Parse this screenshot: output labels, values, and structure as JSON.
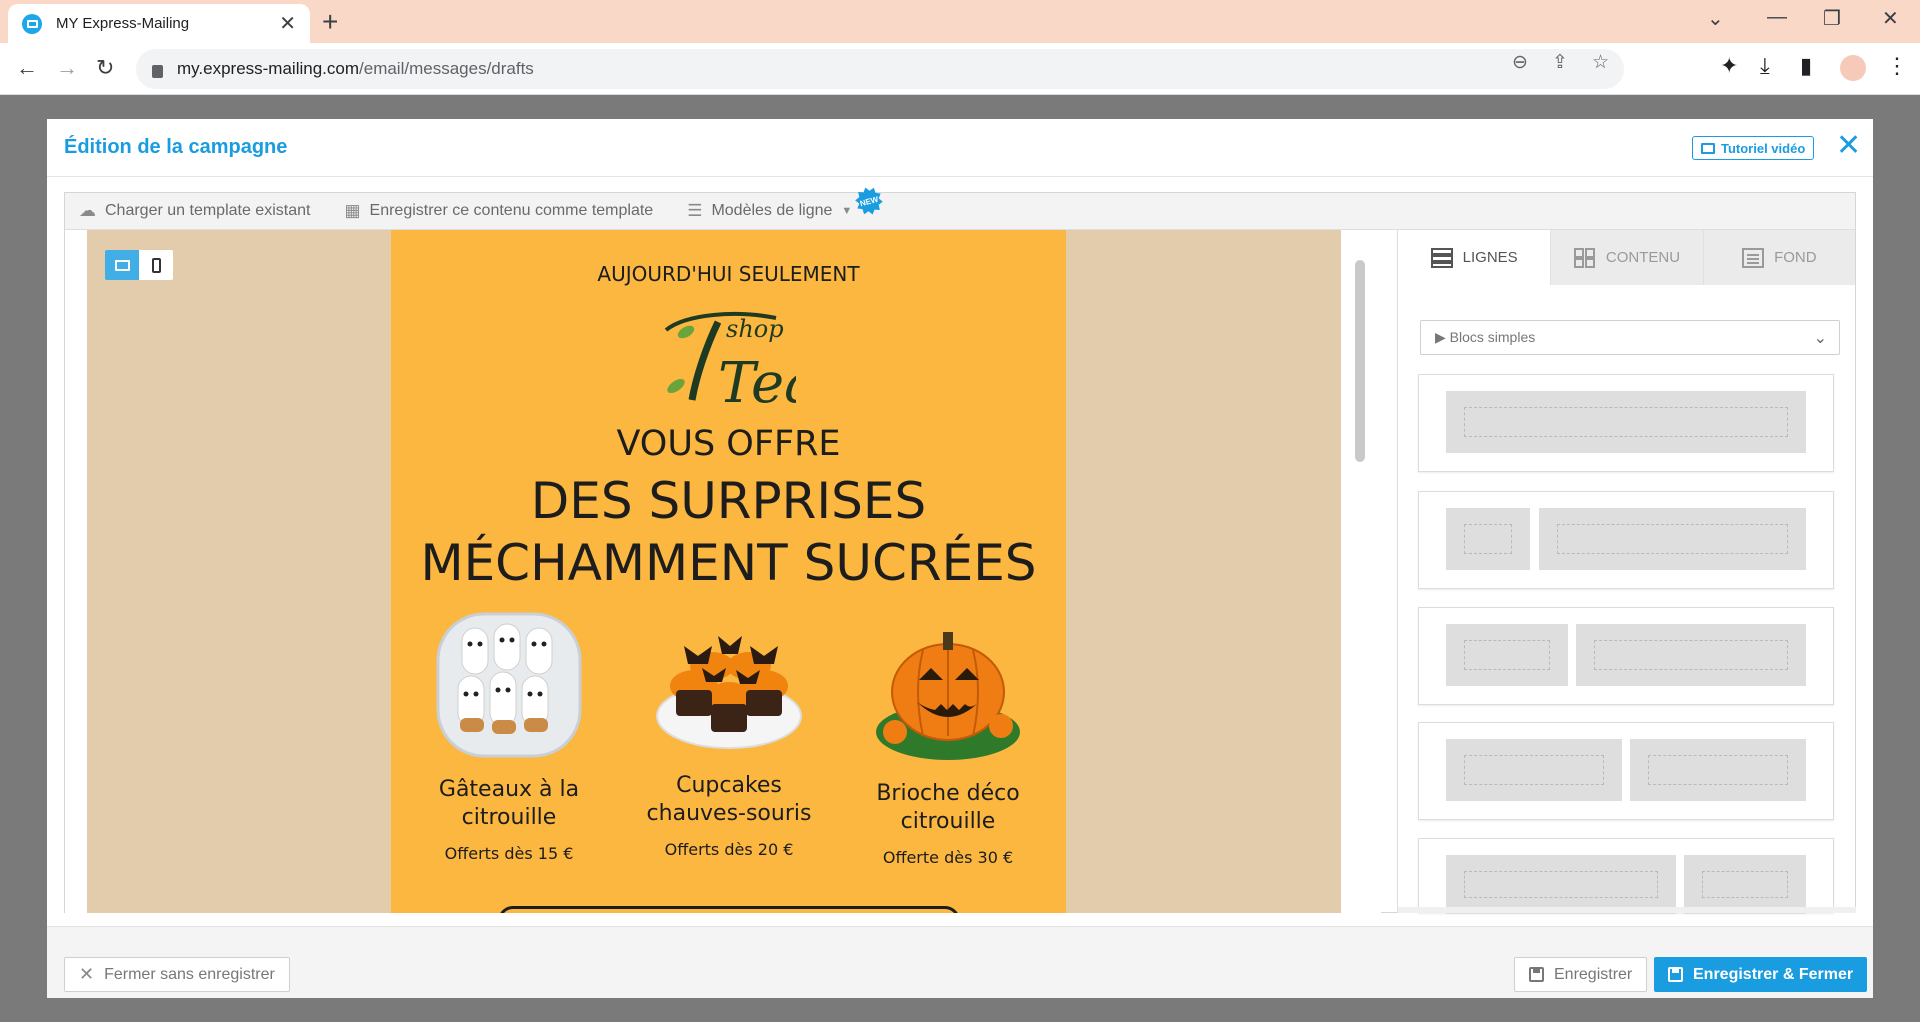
{
  "browser": {
    "tab_title": "MY Express-Mailing",
    "url_host": "my.express-mailing.com",
    "url_path": "/email/messages/drafts"
  },
  "modal": {
    "title": "Édition de la campagne",
    "tutorial_label": "Tutoriel vidéo"
  },
  "toolbar": {
    "load_template": "Charger un template existant",
    "save_as_template": "Enregistrer ce contenu comme template",
    "row_models": "Modèles de ligne",
    "new_badge": "NEW"
  },
  "email": {
    "kicker": "AUJOURD'HUI SEULEMENT",
    "logo_text_small": "shop",
    "logo_text_big": "Tea",
    "line1": "VOUS OFFRE",
    "line2": "DES SURPRISES",
    "line3": "MÉCHAMMENT SUCRÉES",
    "products": [
      {
        "name": "Gâteaux à la citrouille",
        "price": "Offerts dès 15 €"
      },
      {
        "name": "Cupcakes chauves-souris",
        "price": "Offerts dès 20 €"
      },
      {
        "name": "Brioche déco citrouille",
        "price": "Offerte dès 30 €"
      }
    ],
    "background_color": "#fbb740"
  },
  "sidepanel": {
    "tabs": [
      "LIGNES",
      "CONTENU",
      "FOND"
    ],
    "select_value": "▶ Blocs simples"
  },
  "footer": {
    "close_label": "Fermer sans enregistrer",
    "save_label": "Enregistrer",
    "save_close_label": "Enregistrer & Fermer"
  },
  "colors": {
    "accent": "#1a9ce0",
    "canvas": "#e3ccab"
  }
}
